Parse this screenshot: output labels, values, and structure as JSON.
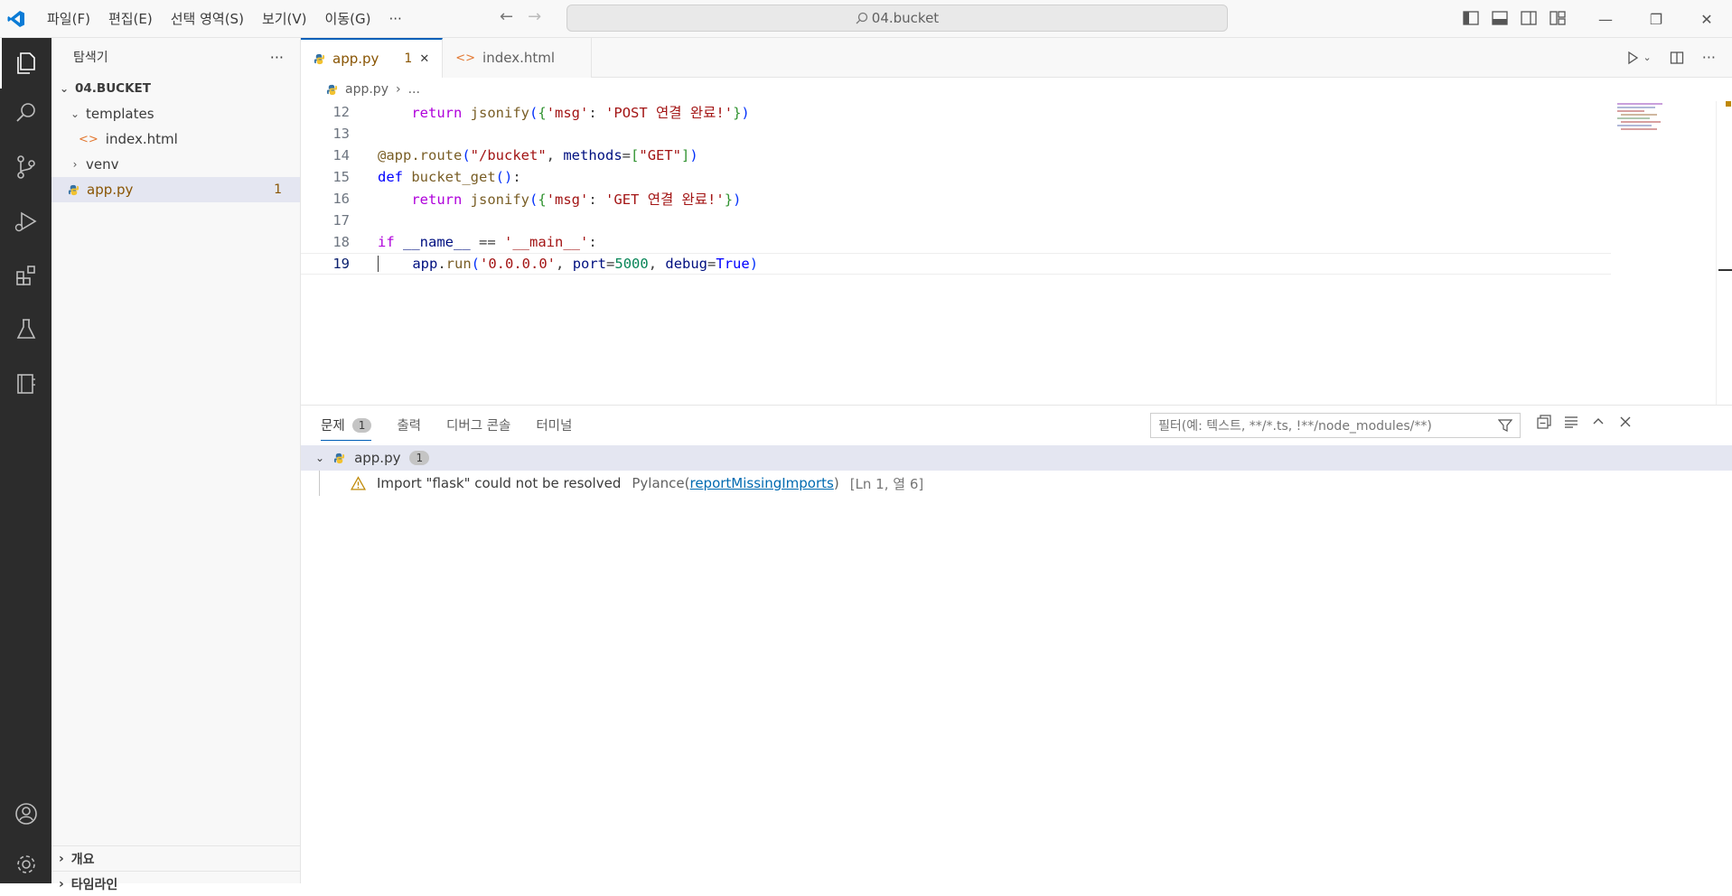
{
  "titlebar": {
    "menu": [
      "파일(F)",
      "편집(E)",
      "선택 영역(S)",
      "보기(V)",
      "이동(G)",
      "···"
    ],
    "search_text": "04.bucket"
  },
  "sidebar": {
    "title": "탐색기",
    "more": "···",
    "root": "04.BUCKET",
    "items": [
      {
        "label": "templates"
      },
      {
        "label": "index.html"
      },
      {
        "label": "venv"
      },
      {
        "label": "app.py",
        "badge": "1"
      }
    ],
    "bottom": [
      "개요",
      "타임라인"
    ]
  },
  "tabs": [
    {
      "label": "app.py",
      "badge": "1",
      "close": "✕"
    },
    {
      "label": "index.html"
    }
  ],
  "breadcrumb": {
    "file": "app.py",
    "sep": "›",
    "rest": "..."
  },
  "editor": {
    "line_numbers": [
      "12",
      "13",
      "14",
      "15",
      "16",
      "17",
      "18",
      "19"
    ]
  },
  "panel": {
    "tabs": [
      {
        "label": "문제",
        "count": "1"
      },
      {
        "label": "출력"
      },
      {
        "label": "디버그 콘솔"
      },
      {
        "label": "터미널"
      }
    ],
    "filter_placeholder": "필터(예: 텍스트, **/*.ts, !**/node_modules/**)",
    "problem_file": {
      "name": "app.py",
      "count": "1"
    },
    "problem": {
      "message": "Import \"flask\" could not be resolved",
      "source": "Pylance(",
      "code": "reportMissingImports",
      "source_end": ")",
      "location": "[Ln 1, 열 6]"
    }
  },
  "colors": {
    "activity_bar": "#2c2c2c",
    "accent": "#005fb8",
    "warning": "#bf8803",
    "modified": "#895503"
  }
}
